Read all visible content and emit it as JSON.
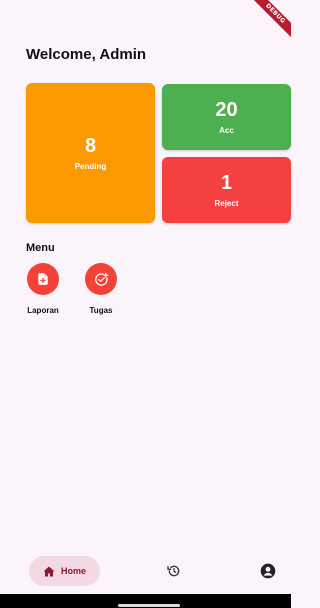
{
  "debug_banner": "DEBUG",
  "header": {
    "title": "Welcome, Admin"
  },
  "stats": {
    "pending": {
      "value": "8",
      "label": "Pending",
      "color": "#fb9a00"
    },
    "acc": {
      "value": "20",
      "label": "Acc",
      "color": "#4caf50"
    },
    "reject": {
      "value": "1",
      "label": "Reject",
      "color": "#f44040"
    }
  },
  "menu": {
    "heading": "Menu",
    "items": [
      {
        "label": "Laporan",
        "icon": "document-add-icon"
      },
      {
        "label": "Tugas",
        "icon": "task-add-icon"
      }
    ]
  },
  "bottom_nav": {
    "home_label": "Home",
    "items": [
      "home-icon",
      "history-icon",
      "account-icon"
    ],
    "accent": "#8e1630"
  }
}
